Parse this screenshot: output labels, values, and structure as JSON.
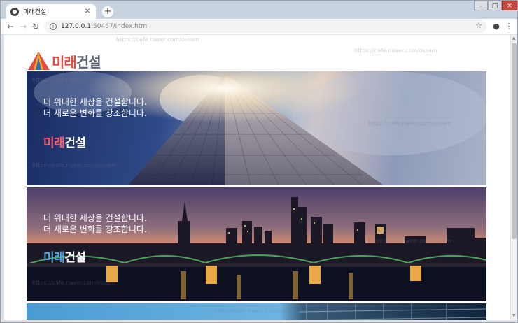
{
  "tab": {
    "title": "미래건설",
    "close_icon": "close-icon"
  },
  "toolbar": {
    "url_host": "127.0.0.1",
    "url_rest": ":50467/index.html"
  },
  "logo": {
    "part1": "미래",
    "part2": "건설"
  },
  "banners": [
    {
      "line1": "더 위대한 세상을 건설합니다.",
      "line2": "더 새로운 변화를 창조합니다.",
      "brand_a": "미래",
      "brand_b": "건설"
    },
    {
      "line1": "더 위대한 세상을 건설합니다.",
      "line2": "더 새로운 변화를 창조합니다.",
      "brand_a": "미래",
      "brand_b": "건설"
    }
  ],
  "watermark": "https://cafe.naver.com/ossam",
  "colors": {
    "brand_red": "#e64a3c",
    "brand_gray": "#5a6570",
    "brand_blue": "#4aa6e0"
  }
}
